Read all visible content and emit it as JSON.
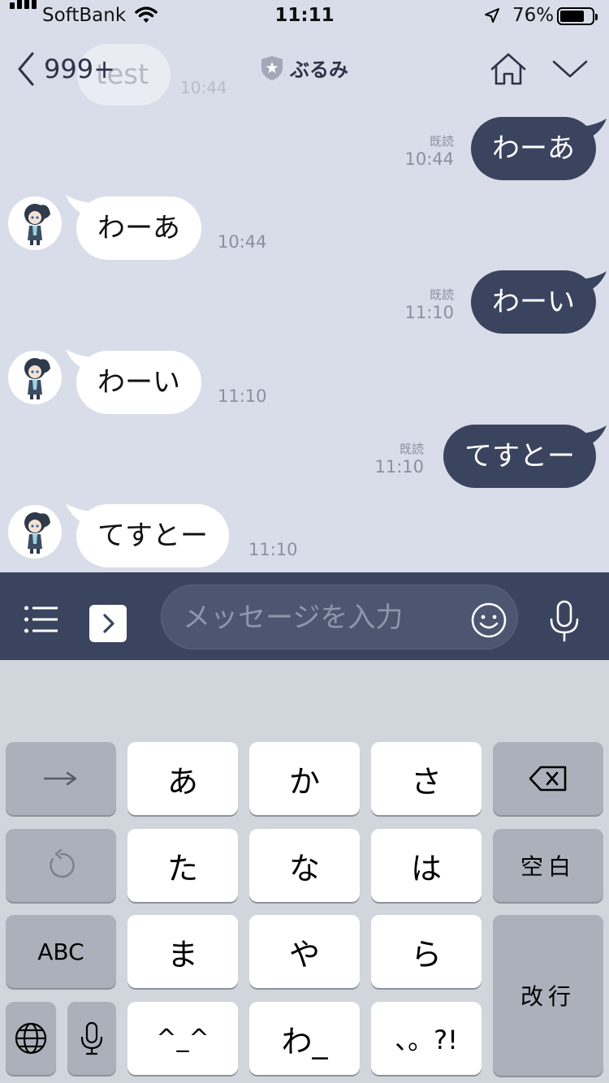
{
  "status_bar": {
    "carrier": "SoftBank",
    "time": "11:11",
    "battery_percent": "76%",
    "battery_level": 0.76
  },
  "header": {
    "back_count": "999+",
    "title": "ぶるみ",
    "ghost_message": "test",
    "ghost_time": "10:44"
  },
  "messages": [
    {
      "side": "out",
      "text": "わーあ",
      "read": "既読",
      "time": "10:44"
    },
    {
      "side": "in",
      "text": "わーあ",
      "time": "10:44"
    },
    {
      "side": "out",
      "text": "わーい",
      "read": "既読",
      "time": "11:10"
    },
    {
      "side": "in",
      "text": "わーい",
      "time": "11:10"
    },
    {
      "side": "out",
      "text": "てすとー",
      "read": "既読",
      "time": "11:10"
    },
    {
      "side": "in",
      "text": "てすとー",
      "time": "11:10"
    }
  ],
  "input_bar": {
    "placeholder": "メッセージを入力"
  },
  "keyboard": {
    "keys": {
      "arrow": "→",
      "a": "あ",
      "ka": "か",
      "sa": "さ",
      "ta": "た",
      "na": "な",
      "ha": "は",
      "space": "空白",
      "abc": "ABC",
      "ma": "ま",
      "ya": "や",
      "ra": "ら",
      "enter": "改行",
      "kaomoji": "^_^",
      "wa": "わ_",
      "punct": "、。?!"
    }
  },
  "colors": {
    "background": "#d9dde9",
    "outgoing_bubble": "#3b445e",
    "incoming_bubble": "#ffffff",
    "input_bar": "#3b445e",
    "keyboard": "#d1d5dc"
  }
}
